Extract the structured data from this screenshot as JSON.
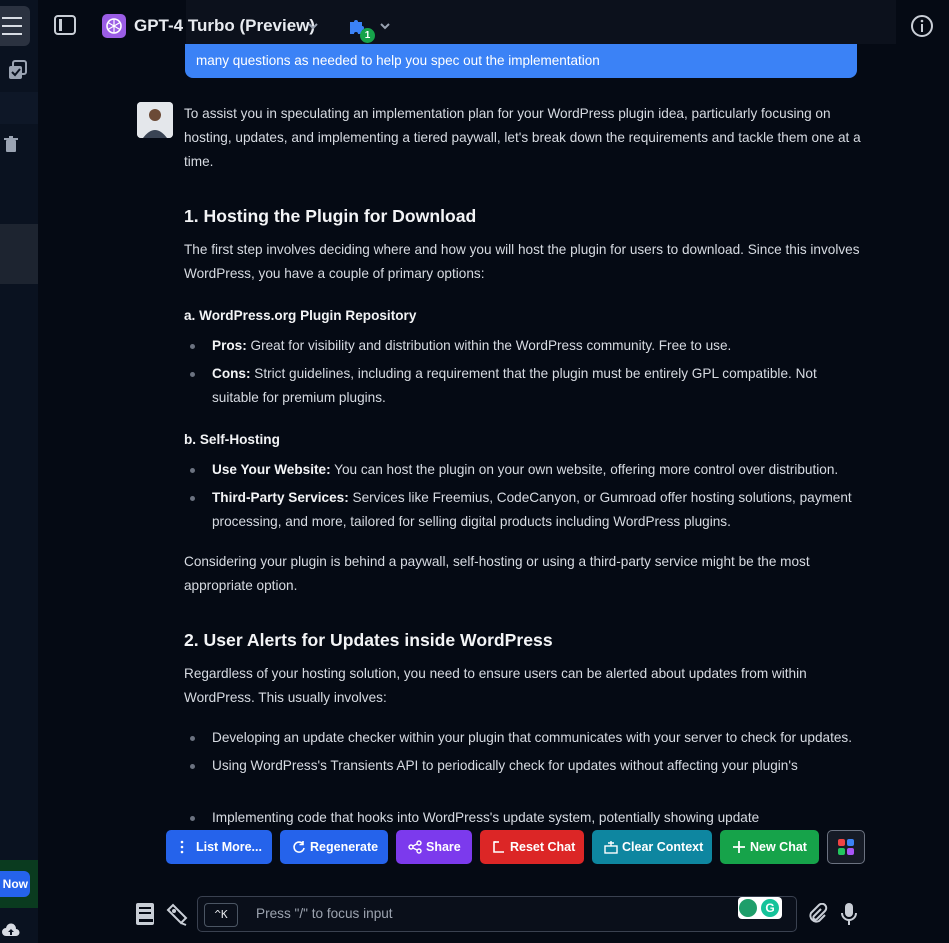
{
  "topbar": {
    "model_name": "GPT-4 Turbo (Preview)",
    "plugin_count": "1"
  },
  "sidebar": {
    "now_button": "Now"
  },
  "user_message": {
    "visible_line": "many questions as needed to help you spec out the implementation"
  },
  "assistant": {
    "intro": "To assist you in speculating an implementation plan for your WordPress plugin idea, particularly focusing on hosting, updates, and implementing a tiered paywall, let's break down the requirements and tackle them one at a time.",
    "s1_title": "1. Hosting the Plugin for Download",
    "s1_text": "The first step involves deciding where and how you will host the plugin for users to download. Since this involves WordPress, you have a couple of primary options:",
    "s1a_title": "a. WordPress.org Plugin Repository",
    "s1a_items": [
      {
        "label": "Pros:",
        "text": " Great for visibility and distribution within the WordPress community. Free to use."
      },
      {
        "label": "Cons:",
        "text": " Strict guidelines, including a requirement that the plugin must be entirely GPL compatible. Not suitable for premium plugins."
      }
    ],
    "s1b_title": "b. Self-Hosting",
    "s1b_items": [
      {
        "label": "Use Your Website:",
        "text": " You can host the plugin on your own website, offering more control over distribution."
      },
      {
        "label": "Third-Party Services:",
        "text": " Services like Freemius, CodeCanyon, or Gumroad offer hosting solutions, payment processing, and more, tailored for selling digital products including WordPress plugins."
      }
    ],
    "s1_conclusion": "Considering your plugin is behind a paywall, self-hosting or using a third-party service might be the most appropriate option.",
    "s2_title": "2. User Alerts for Updates inside WordPress",
    "s2_text": "Regardless of your hosting solution, you need to ensure users can be alerted about updates from within WordPress. This usually involves:",
    "s2_items": [
      "Developing an update checker within your plugin that communicates with your server to check for updates.",
      "Using WordPress's Transients API to periodically check for updates without affecting your plugin's",
      "Implementing code that hooks into WordPress's update system, potentially showing update"
    ]
  },
  "actions": {
    "list_more": "List More...",
    "regenerate": "Regenerate",
    "share": "Share",
    "reset_chat": "Reset Chat",
    "clear_context": "Clear Context",
    "new_chat": "New Chat"
  },
  "input": {
    "shortcut": "^K",
    "placeholder": "Press \"/\" to focus input"
  }
}
